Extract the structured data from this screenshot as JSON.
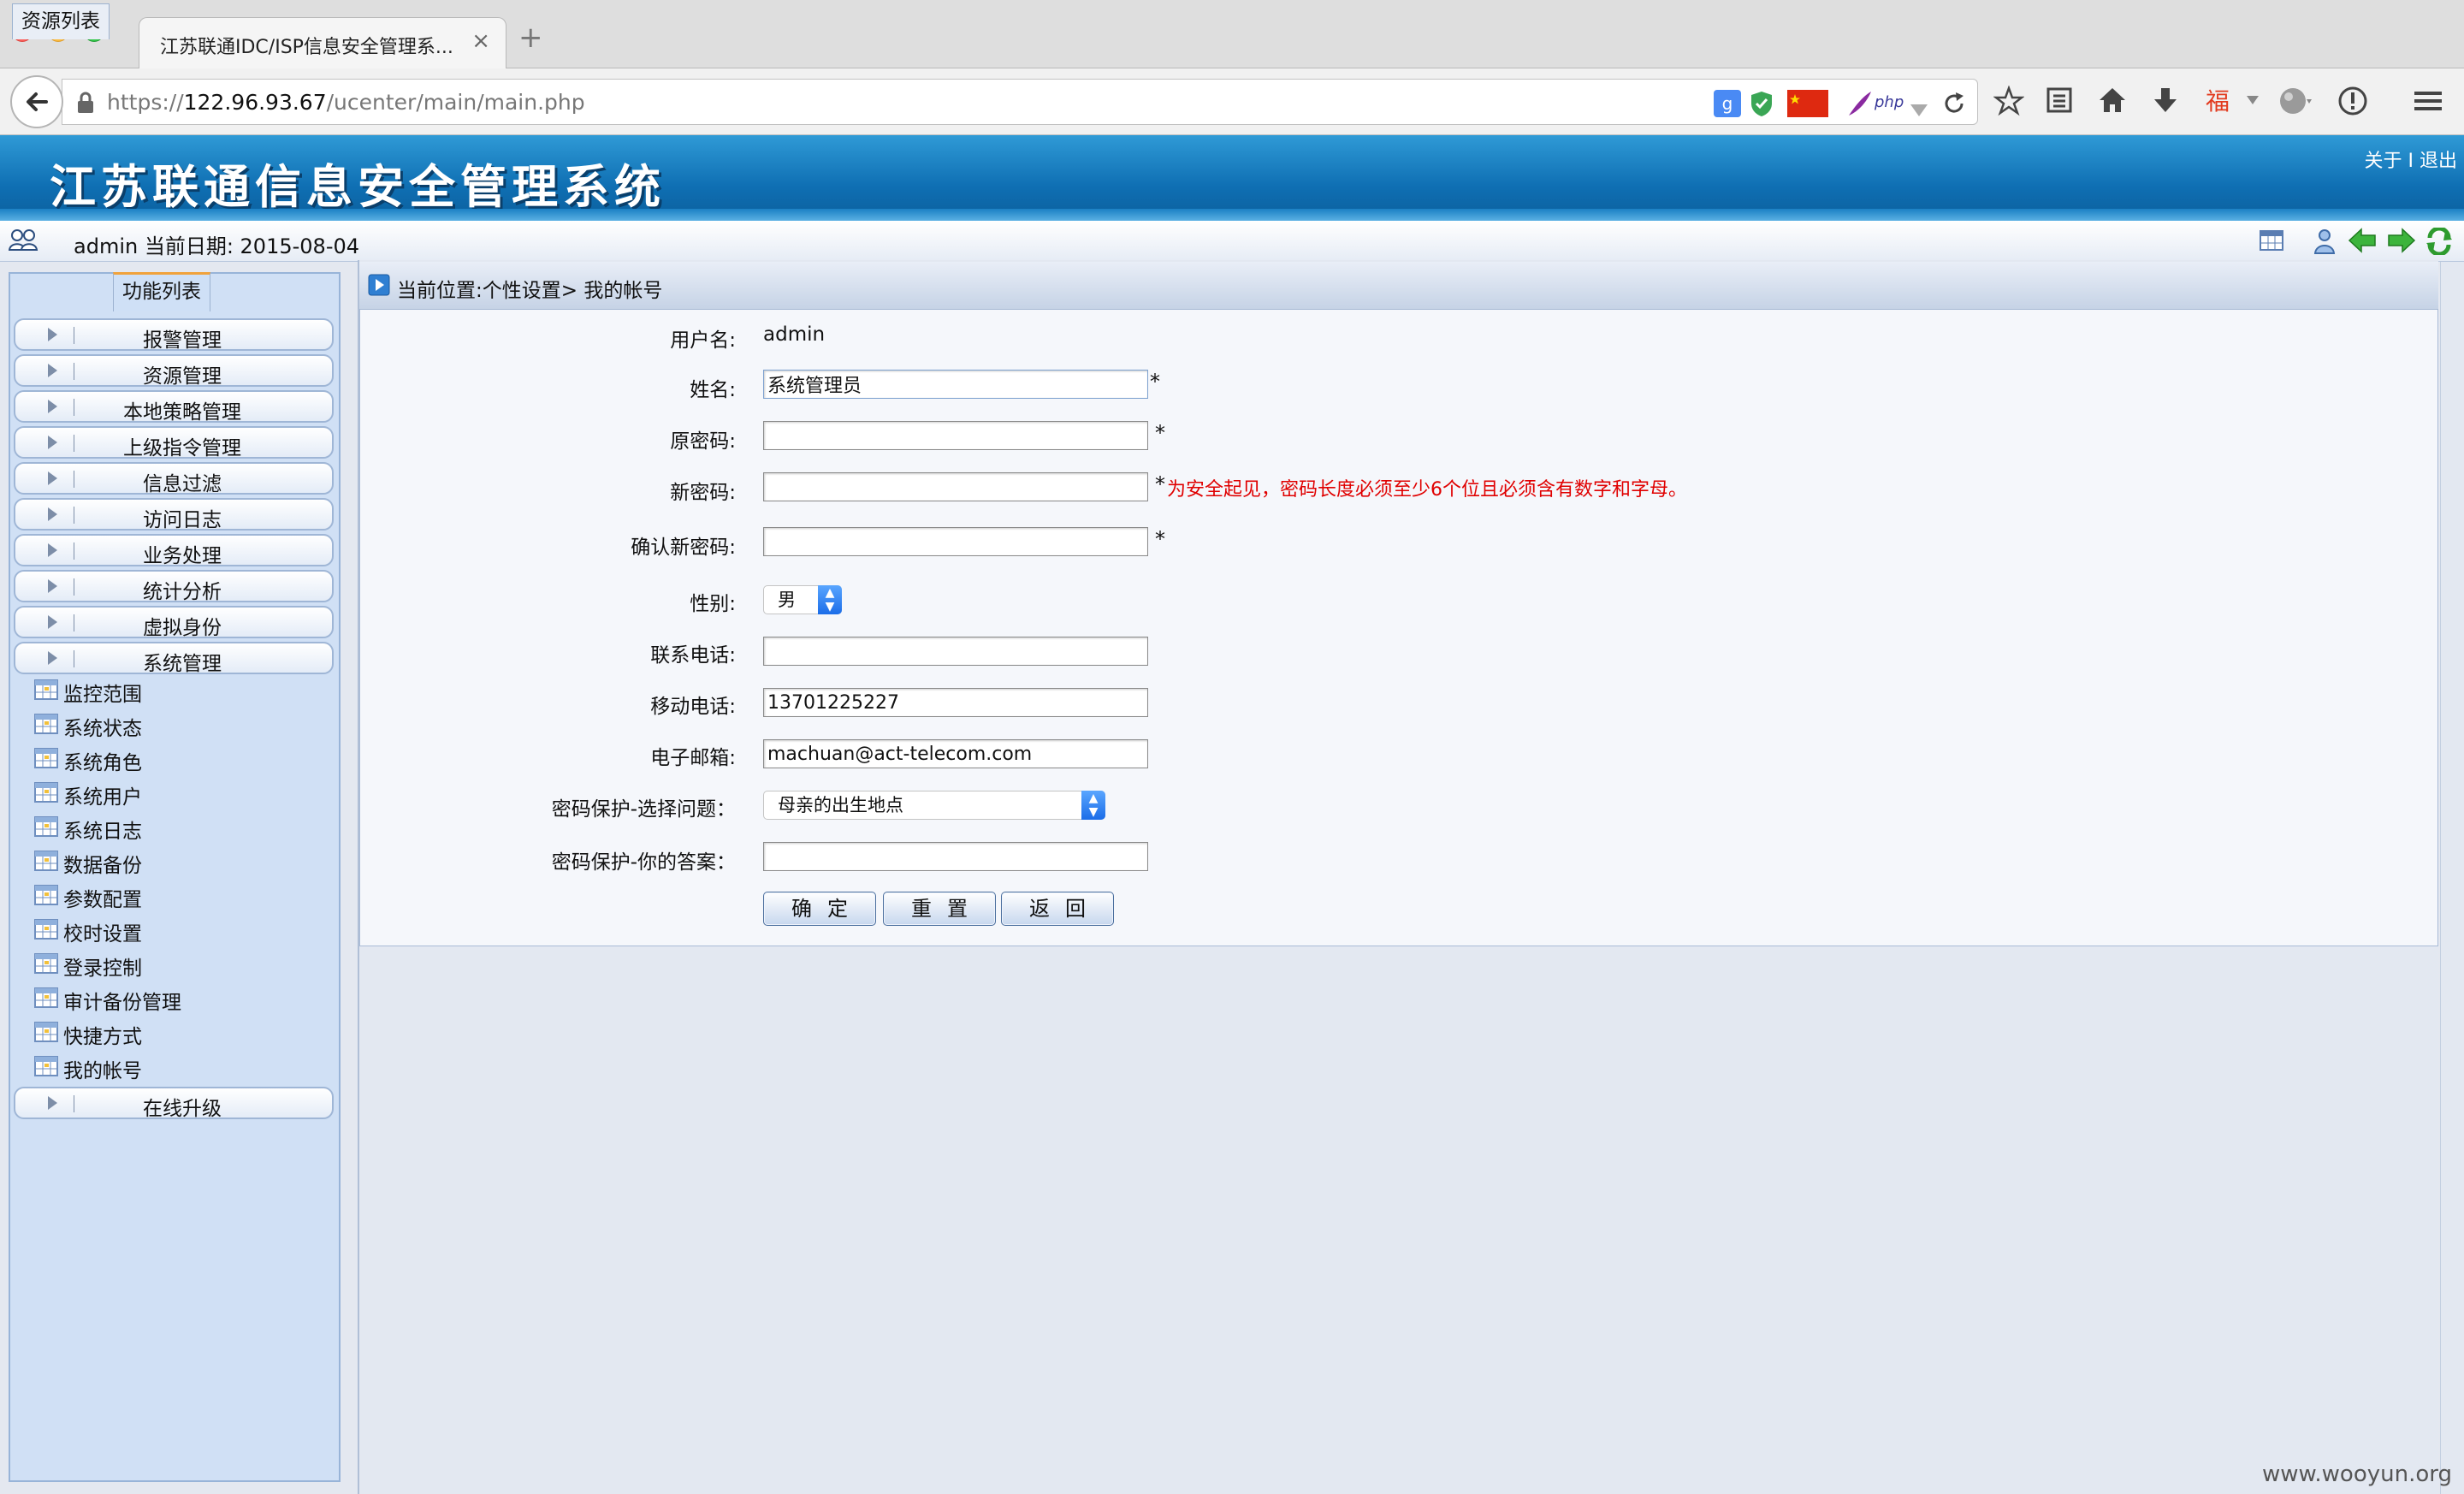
{
  "browser": {
    "tab_title": "江苏联通IDC/ISP信息安全管理系...",
    "tab_close": "×",
    "new_tab": "+",
    "url_prefix": "https://",
    "url_host": "122.96.93.67",
    "url_path": "/ucenter/main/main.php",
    "addon_php": "php"
  },
  "app": {
    "title": "江苏联通信息安全管理系统",
    "header_about": "关于",
    "header_sep": " I ",
    "header_logout": "退出",
    "user_line": "admin   当前日期: 2015-08-04"
  },
  "sidebar": {
    "tabs": [
      "资源列表",
      "功能列表"
    ],
    "active_tab": "功能列表",
    "groups": [
      "报警管理",
      "资源管理",
      "本地策略管理",
      "上级指令管理",
      "信息过滤",
      "访问日志",
      "业务处理",
      "统计分析",
      "虚拟身份",
      "系统管理"
    ],
    "sub_items": [
      "监控范围",
      "系统状态",
      "系统角色",
      "系统用户",
      "系统日志",
      "数据备份",
      "参数配置",
      "校时设置",
      "登录控制",
      "审计备份管理",
      "快捷方式",
      "我的帐号"
    ],
    "bottom_group": "在线升级"
  },
  "main": {
    "breadcrumb": "当前位置:个性设置> 我的帐号",
    "form": {
      "username_label": "用户名:",
      "username_value": "admin",
      "name_label": "姓名:",
      "name_value": "系统管理员",
      "old_pw_label": "原密码:",
      "old_pw_value": "",
      "new_pw_label": "新密码:",
      "new_pw_value": "",
      "new_pw_hint": "为安全起见，密码长度必须至少6个位且必须含有数字和字母。",
      "confirm_pw_label": "确认新密码:",
      "confirm_pw_value": "",
      "gender_label": "性别:",
      "gender_value": "男",
      "phone_label": "联系电话:",
      "phone_value": "",
      "mobile_label": "移动电话:",
      "mobile_value": "13701225227",
      "email_label": "电子邮箱:",
      "email_value": "machuan@act-telecom.com",
      "question_label": "密码保护-选择问题：",
      "question_value": "母亲的出生地点",
      "answer_label": "密码保护-你的答案：",
      "answer_value": "",
      "required_mark": "*",
      "btn_ok": "确定",
      "btn_reset": "重置",
      "btn_back": "返回"
    }
  },
  "watermark": "www.wooyun.org",
  "colors": {
    "header_blue": "#0f6fb3",
    "sidebar_bg": "#d0e0f5",
    "hint_red": "#e00000",
    "active_tab_accent": "#f0a23c"
  }
}
